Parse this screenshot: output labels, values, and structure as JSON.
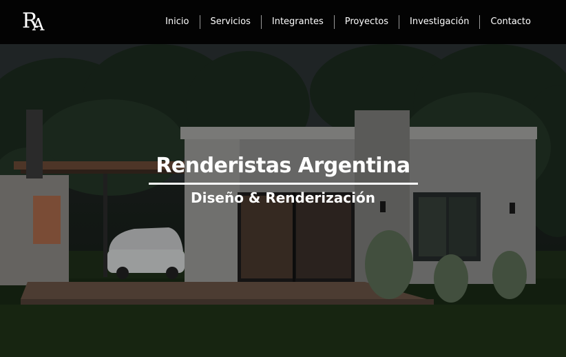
{
  "brand": {
    "logo_r": "R",
    "logo_a": "A"
  },
  "nav": {
    "items": [
      {
        "label": "Inicio"
      },
      {
        "label": "Servicios"
      },
      {
        "label": "Integrantes"
      },
      {
        "label": "Proyectos"
      },
      {
        "label": "Investigación"
      },
      {
        "label": "Contacto"
      }
    ]
  },
  "hero": {
    "title": "Renderistas Argentina",
    "subtitle": "Diseño & Renderización"
  }
}
